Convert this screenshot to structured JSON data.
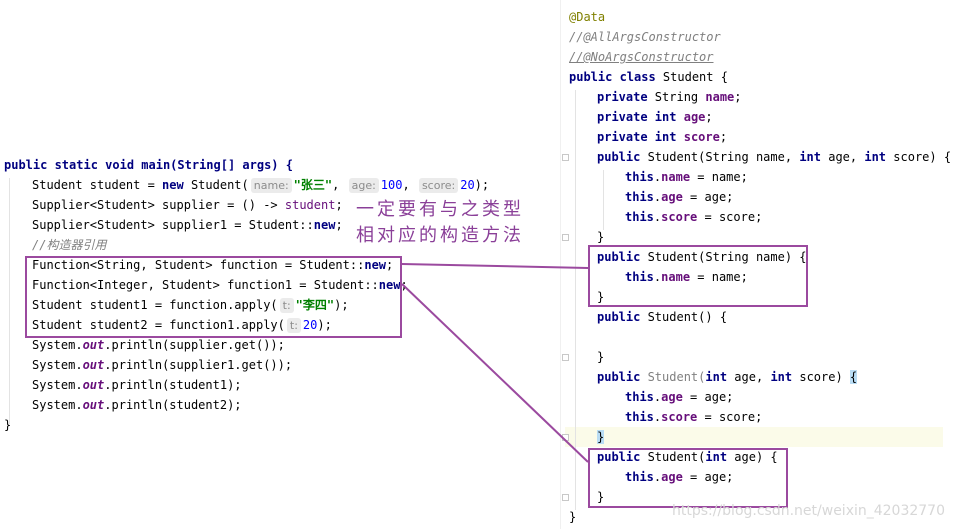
{
  "left_code": {
    "method_sig": "public static void main(String[] args) {",
    "l1_a": "Student student = ",
    "l1_new": "new",
    "l1_b": " Student(",
    "l1_hint_name": "name:",
    "l1_str": "\"张三\"",
    "l1_c": ",",
    "l1_hint_age": "age:",
    "l1_num_age": "100",
    "l1_d": ",",
    "l1_hint_score": "score:",
    "l1_num_score": "20",
    "l1_e": ");",
    "l2_a": "Supplier<Student> supplier = () -> ",
    "l2_b": "student",
    "l2_c": ";",
    "l3_a": "Supplier<Student> supplier1 = Student::",
    "l3_b": "new",
    "l3_c": ";",
    "l4_comment": "//构造器引用",
    "l5_a": "Function<String, Student> function = Student::",
    "l5_b": "new",
    "l5_c": ";",
    "l6_a": "Function<Integer, Student> function1 = Student::",
    "l6_b": "new",
    "l6_c": ";",
    "l7_a": "Student student1 = function.apply(",
    "l7_hint": "t:",
    "l7_str": "\"李四\"",
    "l7_c": ");",
    "l8_a": "Student student2 = function1.apply(",
    "l8_hint": "t:",
    "l8_num": "20",
    "l8_c": ");",
    "l9_a": "System.",
    "l9_out": "out",
    "l9_b": ".println(supplier.get());",
    "l10_a": "System.",
    "l10_out": "out",
    "l10_b": ".println(supplier1.get());",
    "l11_a": "System.",
    "l11_out": "out",
    "l11_b": ".println(student1);",
    "l12_a": "System.",
    "l12_out": "out",
    "l12_b": ".println(student2);",
    "close": "}"
  },
  "right_code": {
    "ann1": "@Data",
    "ann2": "//@AllArgsConstructor",
    "ann3": "//@NoArgsConstructor",
    "class_kw": "public class",
    "class_name": " Student {",
    "f1_kw": "private",
    "f1_type": " String ",
    "f1_name": "name",
    "f1_end": ";",
    "f2_kw": "private int",
    "f2_name": "age",
    "f2_end": ";",
    "f3_kw": "private int",
    "f3_name": "score",
    "f3_end": ";",
    "c1_kw": "public",
    "c1_a": " Student(String name, ",
    "c1_int1": "int",
    "c1_b": " age, ",
    "c1_int2": "int",
    "c1_c": " score) {",
    "c1_l1_this": "this",
    "c1_l1_dot": ".",
    "c1_l1_fld": "name",
    "c1_l1_rest": " = name;",
    "c1_l2_this": "this",
    "c1_l2_dot": ".",
    "c1_l2_fld": "age",
    "c1_l2_rest": " = age;",
    "c1_l3_this": "this",
    "c1_l3_dot": ".",
    "c1_l3_fld": "score",
    "c1_l3_rest": " = score;",
    "c1_close": "}",
    "c2_kw": "public",
    "c2_a": " Student(String name) {",
    "c2_l1_this": "this",
    "c2_l1_dot": ".",
    "c2_l1_fld": "name",
    "c2_l1_rest": " = name;",
    "c2_close": "}",
    "c3_kw": "public",
    "c3_a": " Student() {",
    "c3_close": "}",
    "c4_kw": "public",
    "c4_name": " Student(",
    "c4_int1": "int",
    "c4_b": " age, ",
    "c4_int2": "int",
    "c4_c": " score) ",
    "c4_brace": "{",
    "c4_l1_this": "this",
    "c4_l1_dot": ".",
    "c4_l1_fld": "age",
    "c4_l1_rest": " = age;",
    "c4_l2_this": "this",
    "c4_l2_dot": ".",
    "c4_l2_fld": "score",
    "c4_l2_rest": " = score;",
    "c4_close": "}",
    "c5_kw": "public",
    "c5_a": " Student(",
    "c5_int": "int",
    "c5_b": " age) {",
    "c5_l1_this": "this",
    "c5_l1_dot": ".",
    "c5_l1_fld": "age",
    "c5_l1_rest": " = age;",
    "c5_close": "}",
    "class_close": "}"
  },
  "annotation": {
    "line1": "一定要有与之类型",
    "line2": "相对应的构造方法"
  },
  "watermark": "https://blog.csdn.net/weixin_42032770",
  "colors": {
    "keyword": "#000080",
    "field": "#660e7a",
    "string": "#008000",
    "number": "#0000ff",
    "comment": "#808080",
    "annotation_marker": "#808000",
    "callout": "#9b4a9f"
  }
}
